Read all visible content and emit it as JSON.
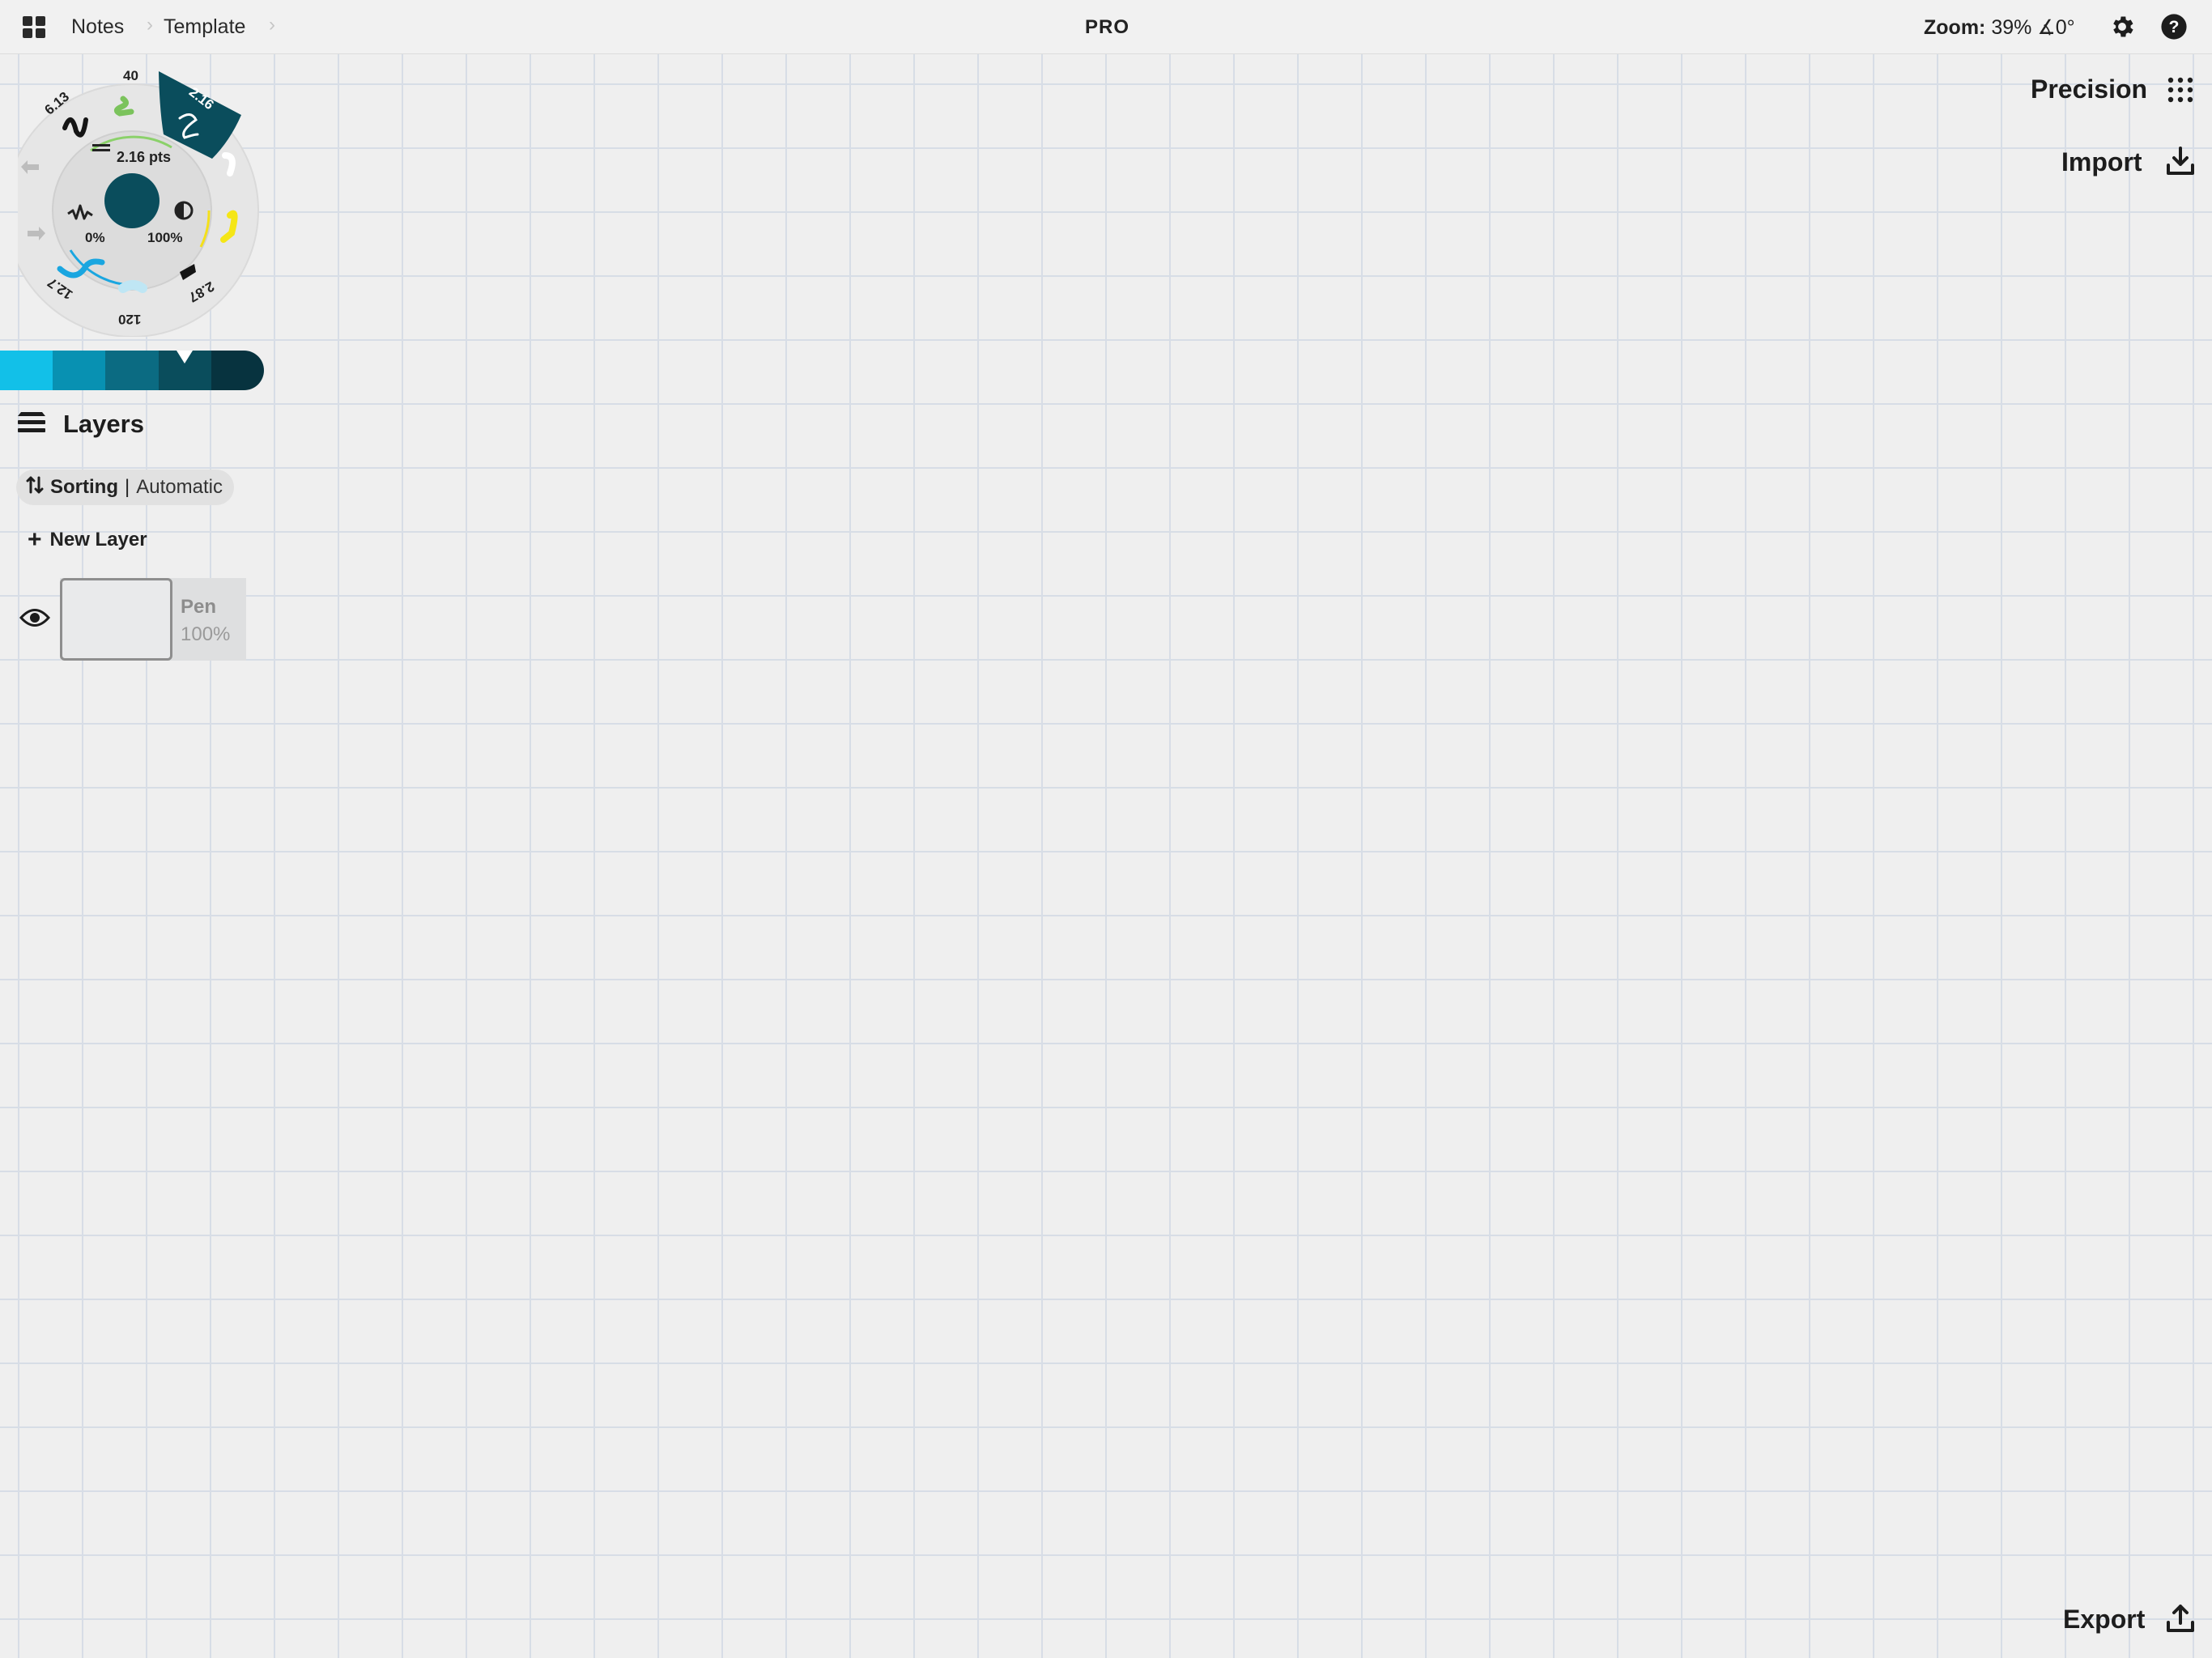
{
  "topbar": {
    "crumbs": [
      "Notes",
      "Template"
    ],
    "badge": "PRO",
    "zoom_label": "Zoom:",
    "zoom_value": "39%",
    "angle_value": "∡0°"
  },
  "right_panel": {
    "precision_label": "Precision",
    "import_label": "Import",
    "export_label": "Export"
  },
  "brush_wheel": {
    "size_readout": "2.16 pts",
    "smoothing": "0%",
    "opacity": "100%",
    "presets": [
      "6.13",
      "40",
      "2.16",
      "12.7",
      "120",
      "2.87"
    ],
    "active_color": "#0a4d5c"
  },
  "color_strip": {
    "swatches": [
      "#12c0e8",
      "#0891b2",
      "#0b6b82",
      "#0a4d5c",
      "#07333f"
    ]
  },
  "layers": {
    "title": "Layers",
    "sorting_label": "Sorting",
    "sorting_separator": "|",
    "sorting_value": "Automatic",
    "new_layer_label": "New Layer",
    "items": [
      {
        "name": "Pen",
        "opacity": "100%",
        "visible": true
      }
    ]
  }
}
